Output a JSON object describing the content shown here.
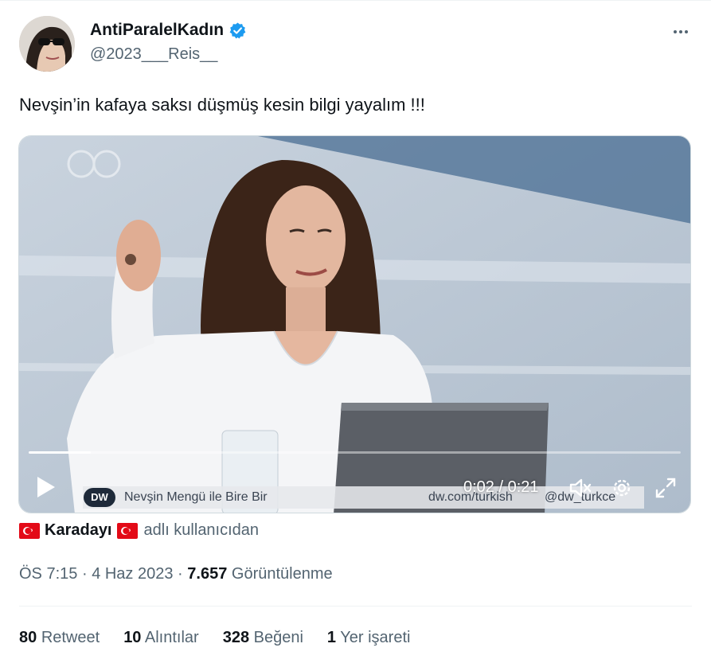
{
  "author": {
    "display_name": "AntiParalelKadın",
    "handle": "@2023___Reis__",
    "verified_icon": "verified-badge-icon",
    "verified_color": "#1d9bf0"
  },
  "tweet": {
    "text": "Nevşin’in kafaya saksı düşmüş kesin bilgi yayalım !!!"
  },
  "video": {
    "time_label": "0:02 / 0:21",
    "progress": 0.095,
    "watermark": "dw",
    "lower_third": {
      "logo": "DW",
      "program": "Nevşin Mengü ile Bire Bir",
      "site": "dw.com/turkish",
      "twitter": "@dw_turkce"
    }
  },
  "source": {
    "user": "Karadayı",
    "suffix": "adlı kullanıcıdan",
    "flag_icon": "turkey-flag-icon"
  },
  "meta": {
    "time": "ÖS 7:15",
    "date": "4 Haz 2023",
    "sep": "·",
    "views_count": "7.657",
    "views_label": "Görüntülenme"
  },
  "stats": {
    "retweets": {
      "count": "80",
      "label": "Retweet"
    },
    "quotes": {
      "count": "10",
      "label": "Alıntılar"
    },
    "likes": {
      "count": "328",
      "label": "Beğeni"
    },
    "bookmarks": {
      "count": "1",
      "label": "Yer işareti"
    }
  },
  "colors": {
    "text_primary": "#0f1419",
    "text_secondary": "#536471",
    "flag_red": "#e30a17"
  }
}
